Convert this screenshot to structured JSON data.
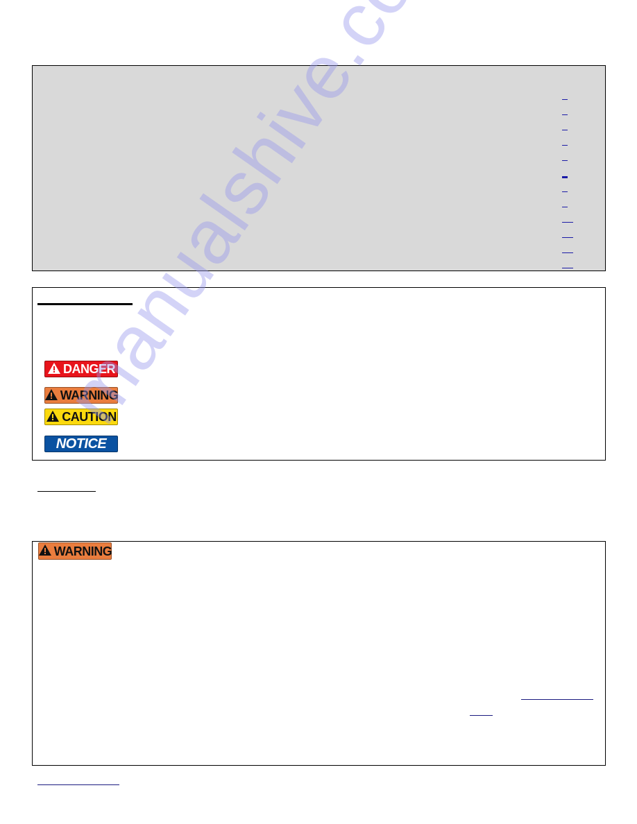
{
  "document": {
    "watermark": "manualshive.com",
    "toc": {
      "entries": [
        {
          "page_link": ""
        },
        {
          "page_link": ""
        },
        {
          "page_link": ""
        },
        {
          "page_link": ""
        },
        {
          "page_link": ""
        },
        {
          "page_link": ""
        },
        {
          "page_link": ""
        },
        {
          "page_link": ""
        },
        {
          "page_link": ""
        },
        {
          "page_link": ""
        },
        {
          "page_link": ""
        },
        {
          "page_link": ""
        }
      ]
    },
    "signal_words": {
      "heading": "",
      "signs": [
        {
          "label": "DANGER",
          "icon": "warning-triangle-icon",
          "color": "#e8141c"
        },
        {
          "label": "WARNING",
          "icon": "warning-triangle-icon",
          "color": "#ea7d3e"
        },
        {
          "label": "CAUTION",
          "icon": "warning-triangle-icon",
          "color": "#fbd90e"
        },
        {
          "label": "NOTICE",
          "icon": "",
          "color": "#0a52a1"
        }
      ]
    },
    "section": {
      "heading": ""
    },
    "warning_box": {
      "sign_label": "WARNING",
      "sign_color": "#ea7d3e",
      "links": [
        "",
        ""
      ]
    },
    "footer_link": ""
  }
}
